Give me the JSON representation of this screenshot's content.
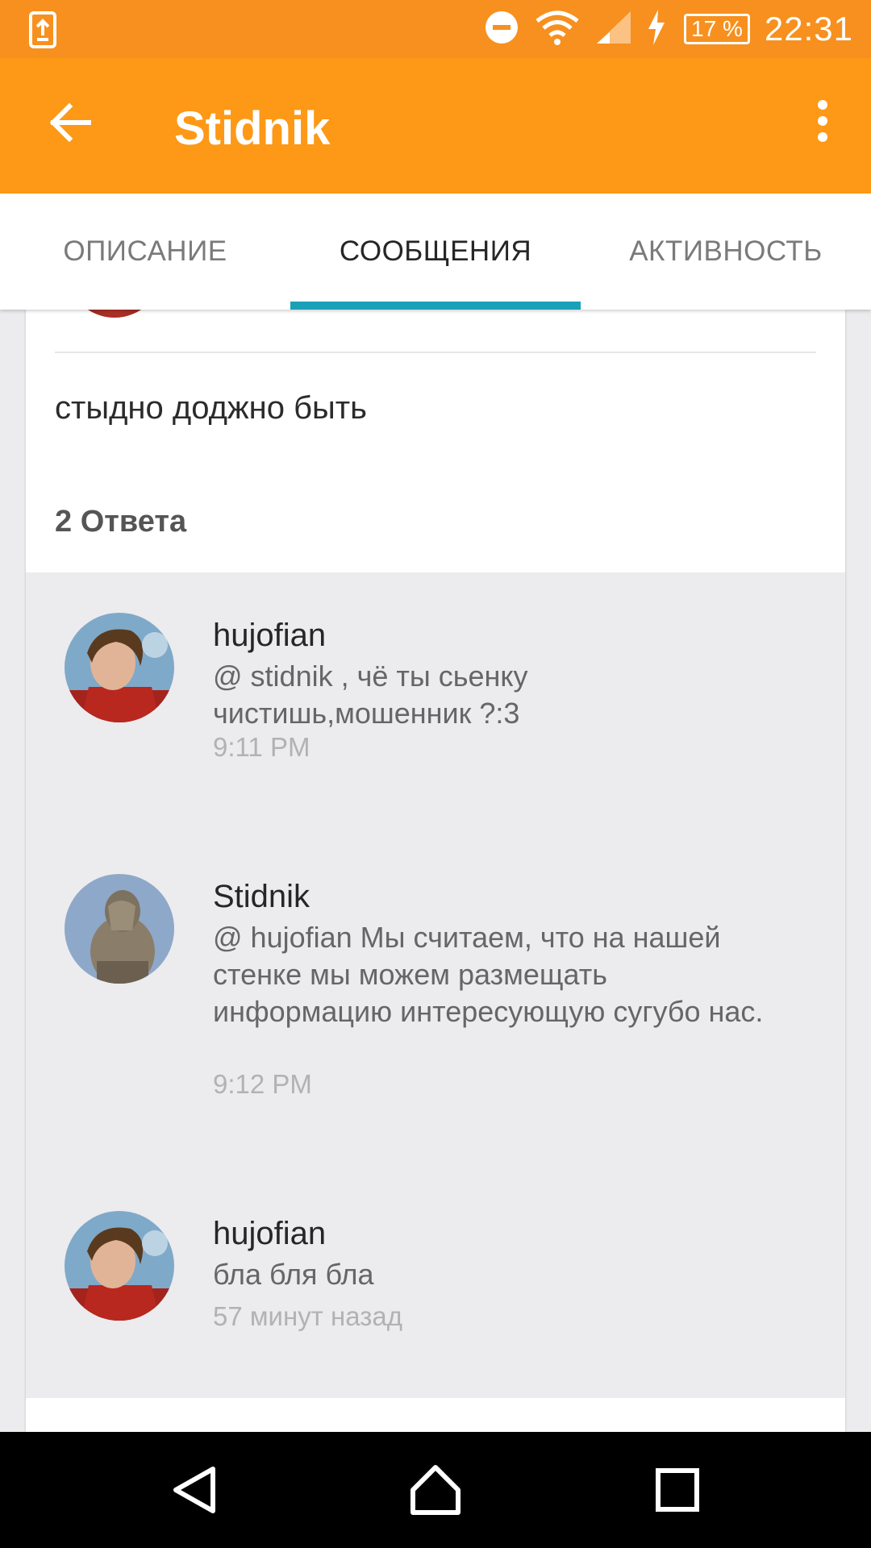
{
  "status_bar": {
    "battery": "17 %",
    "time": "22:31"
  },
  "app_bar": {
    "title": "Stidnik"
  },
  "tabs": [
    {
      "label": "ОПИСАНИЕ",
      "active": false
    },
    {
      "label": "СООБЩЕНИЯ",
      "active": true
    },
    {
      "label": "АКТИВНОСТЬ",
      "active": false
    }
  ],
  "post": {
    "text": "стыдно доджно быть",
    "replies_count": "2 Ответа"
  },
  "replies": [
    {
      "author": "hujofian",
      "message": "@ stidnik , чё ты сьенку чистишь,мошенник ?:3",
      "time": "9:11 PM"
    },
    {
      "author": "Stidnik",
      "message": "@ hujofian  Мы считаем, что на нашей стенке мы можем размещать информацию интересующую сугубо нас.",
      "time": "9:12 PM"
    },
    {
      "author": "hujofian",
      "message": "бла бля бла",
      "time": "57 минут назад"
    }
  ],
  "colors": {
    "status_bar": "#f7901e",
    "app_bar": "#fd9916",
    "tab_indicator": "#1aa0b8",
    "replies_bg": "#ecebee"
  }
}
